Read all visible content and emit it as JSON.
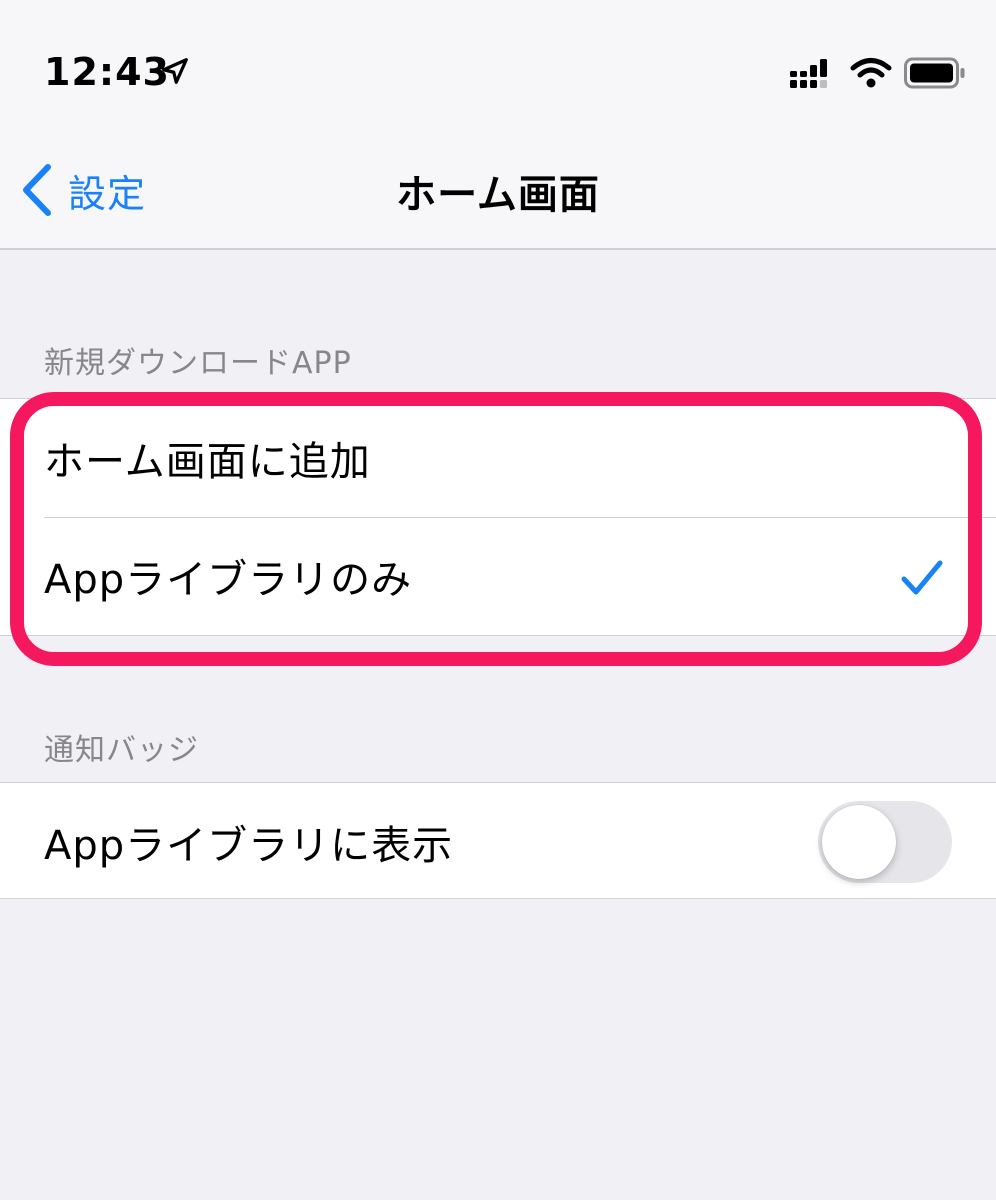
{
  "status_bar": {
    "time": "12:43",
    "icons": [
      "location-arrow-icon",
      "cellular-signal-icon",
      "wifi-icon",
      "battery-icon"
    ]
  },
  "nav": {
    "back_label": "設定",
    "title": "ホーム画面"
  },
  "sections": [
    {
      "header": "新規ダウンロードAPP",
      "rows": [
        {
          "label": "ホーム画面に追加",
          "selected": false
        },
        {
          "label": "Appライブラリのみ",
          "selected": true
        }
      ]
    },
    {
      "header": "通知バッジ",
      "rows": [
        {
          "label": "Appライブラリに表示",
          "toggle_on": false
        }
      ]
    }
  ],
  "colors": {
    "accent": "#1a82f7",
    "highlight": "#f5185f",
    "background": "#f0f0f5",
    "toggle_off": "#e5e5ea"
  }
}
